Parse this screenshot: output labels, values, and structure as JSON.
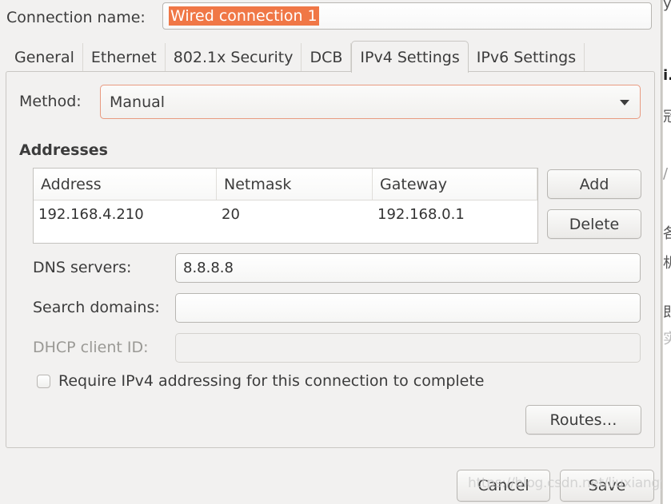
{
  "dialog": {
    "connection_name_label": "Connection name:",
    "connection_name_value": "Wired connection 1",
    "selection_color": "#f07746"
  },
  "tabs": [
    {
      "label": "General",
      "active": false
    },
    {
      "label": "Ethernet",
      "active": false
    },
    {
      "label": "802.1x Security",
      "active": false
    },
    {
      "label": "DCB",
      "active": false
    },
    {
      "label": "IPv4 Settings",
      "active": true
    },
    {
      "label": "IPv6 Settings",
      "active": false
    }
  ],
  "ipv4": {
    "method_label": "Method:",
    "method_value": "Manual",
    "addresses_heading": "Addresses",
    "table": {
      "columns": [
        "Address",
        "Netmask",
        "Gateway"
      ],
      "rows": [
        [
          "192.168.4.210",
          "20",
          "192.168.0.1"
        ]
      ]
    },
    "add_button": "Add",
    "delete_button": "Delete",
    "dns_label": "DNS servers:",
    "dns_value": "8.8.8.8",
    "search_domains_label": "Search domains:",
    "search_domains_value": "",
    "dhcp_client_id_label": "DHCP client ID:",
    "dhcp_client_id_value": "",
    "require_ipv4_label": "Require IPv4 addressing for this connection to complete",
    "require_ipv4_checked": false,
    "routes_button": "Routes…"
  },
  "footer": {
    "cancel_button": "Cancel",
    "save_button": "Save"
  },
  "watermark": "https://blog.csdn.net/liuxiangyang_",
  "background_fragments": [
    "y",
    "i.",
    "冠",
    "/ x",
    "各",
    "机",
    "即",
    "实"
  ]
}
